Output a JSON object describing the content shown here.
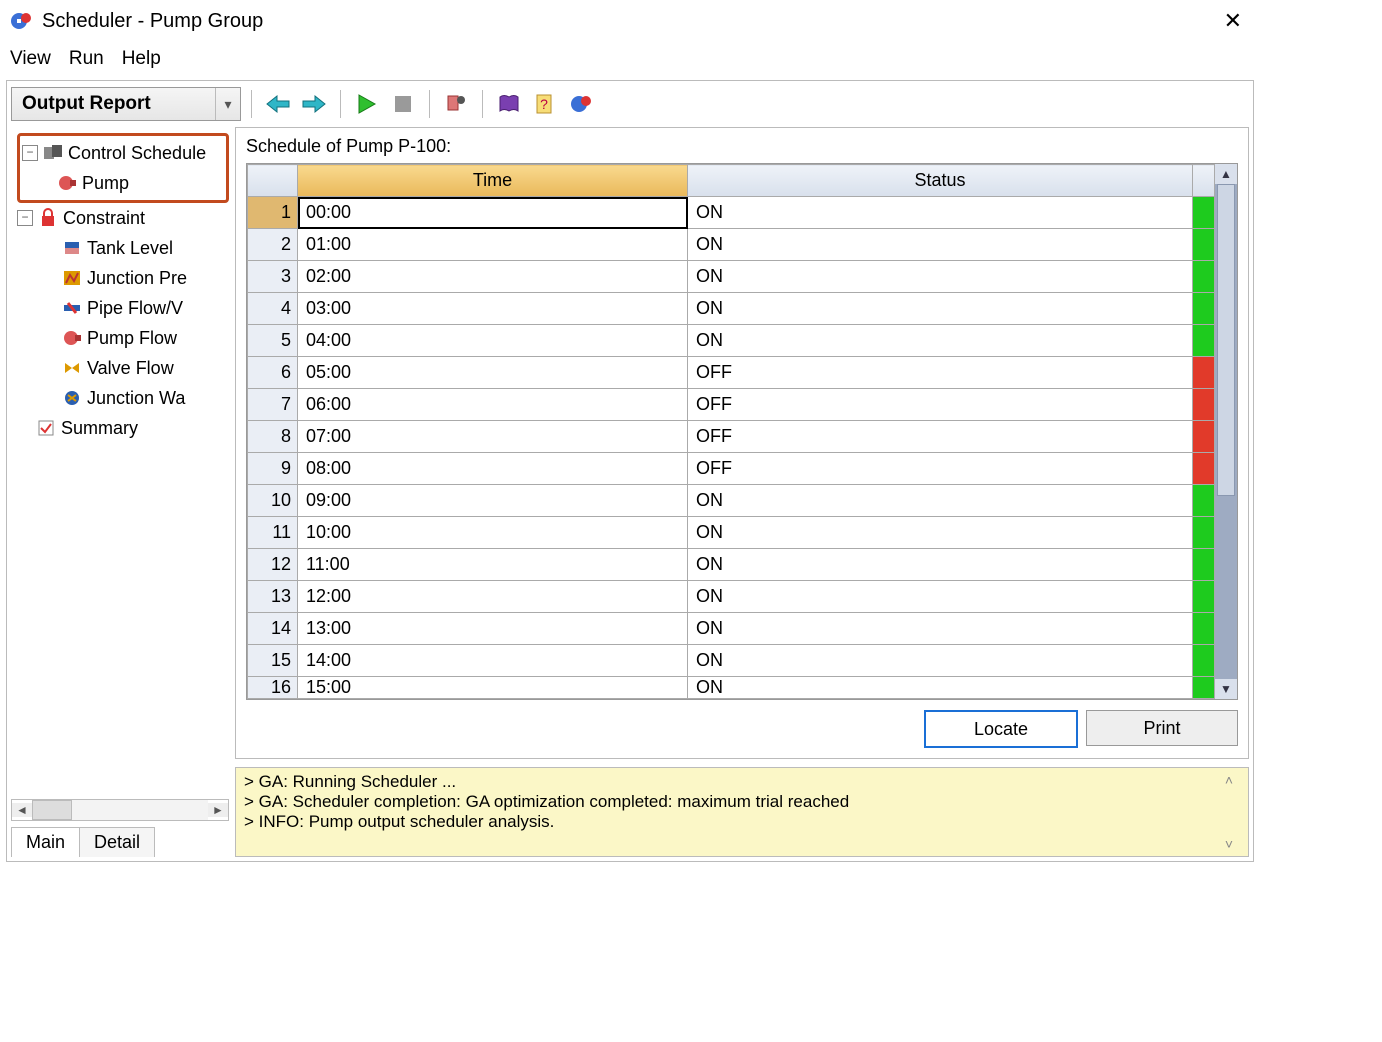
{
  "window": {
    "title": "Scheduler - Pump Group"
  },
  "menu": {
    "view": "View",
    "run": "Run",
    "help": "Help"
  },
  "toolbar": {
    "combo": "Output Report"
  },
  "tree": {
    "control_schedules": "Control Schedule",
    "pump": "Pump",
    "constraint": "Constraint",
    "tank_level": "Tank Level",
    "junction_pre": "Junction Pre",
    "pipe_flow": "Pipe Flow/V",
    "pump_flow": "Pump Flow",
    "valve_flow": "Valve Flow",
    "junction_wa": "Junction Wa",
    "summary": "Summary"
  },
  "tabs": {
    "main": "Main",
    "detail": "Detail"
  },
  "schedule": {
    "title": "Schedule of Pump P-100:",
    "headers": {
      "time": "Time",
      "status": "Status"
    },
    "rows": [
      {
        "n": "1",
        "time": "00:00",
        "status": "ON",
        "on": true,
        "sel": true
      },
      {
        "n": "2",
        "time": "01:00",
        "status": "ON",
        "on": true
      },
      {
        "n": "3",
        "time": "02:00",
        "status": "ON",
        "on": true
      },
      {
        "n": "4",
        "time": "03:00",
        "status": "ON",
        "on": true
      },
      {
        "n": "5",
        "time": "04:00",
        "status": "ON",
        "on": true
      },
      {
        "n": "6",
        "time": "05:00",
        "status": "OFF",
        "on": false
      },
      {
        "n": "7",
        "time": "06:00",
        "status": "OFF",
        "on": false
      },
      {
        "n": "8",
        "time": "07:00",
        "status": "OFF",
        "on": false
      },
      {
        "n": "9",
        "time": "08:00",
        "status": "OFF",
        "on": false
      },
      {
        "n": "10",
        "time": "09:00",
        "status": "ON",
        "on": true
      },
      {
        "n": "11",
        "time": "10:00",
        "status": "ON",
        "on": true
      },
      {
        "n": "12",
        "time": "11:00",
        "status": "ON",
        "on": true
      },
      {
        "n": "13",
        "time": "12:00",
        "status": "ON",
        "on": true
      },
      {
        "n": "14",
        "time": "13:00",
        "status": "ON",
        "on": true
      },
      {
        "n": "15",
        "time": "14:00",
        "status": "ON",
        "on": true
      },
      {
        "n": "16",
        "time": "15:00",
        "status": "ON",
        "on": true,
        "cut": true
      }
    ],
    "buttons": {
      "locate": "Locate",
      "print": "Print"
    }
  },
  "log": {
    "l1": "> GA: Running Scheduler ...",
    "l2": "> GA: Scheduler completion: GA optimization completed: maximum trial reached",
    "l3": "> INFO: Pump output scheduler analysis."
  }
}
